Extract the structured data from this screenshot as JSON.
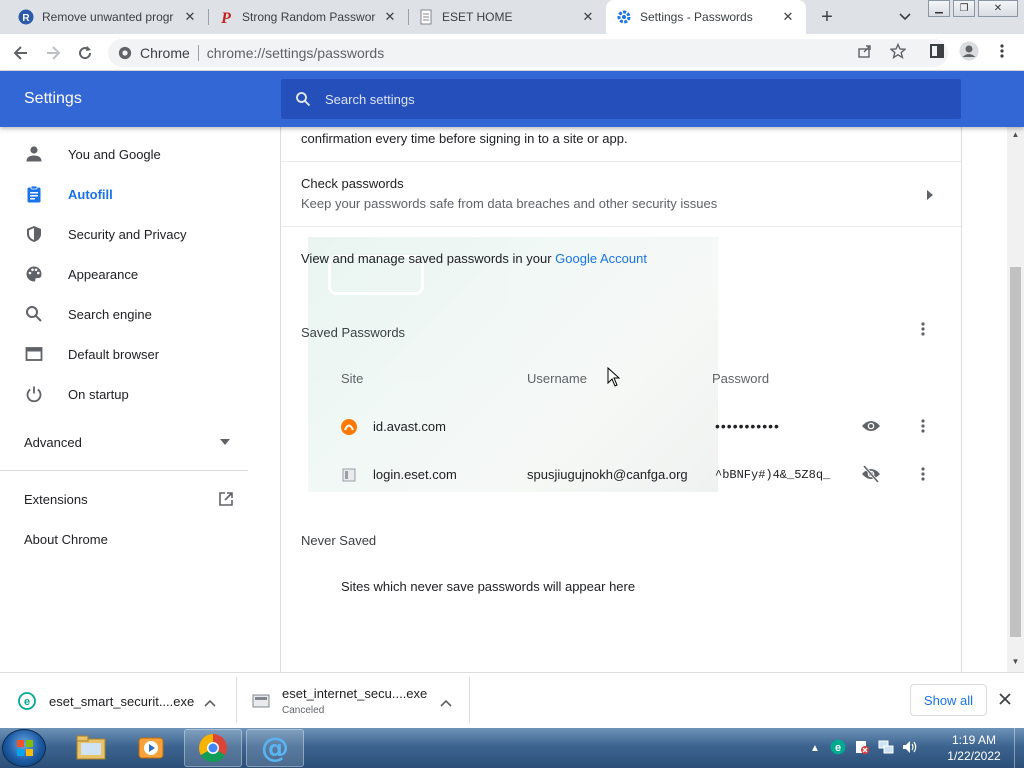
{
  "browser": {
    "tabs": [
      {
        "title": "Remove unwanted progr",
        "favicon": "reimage-icon",
        "active": false
      },
      {
        "title": "Strong Random Passwor",
        "favicon": "password-generator-icon",
        "active": false
      },
      {
        "title": "ESET HOME",
        "favicon": "page-icon",
        "active": false
      },
      {
        "title": "Settings - Passwords",
        "favicon": "gear-icon",
        "active": true
      }
    ],
    "omnibox": {
      "chip": "Chrome",
      "url": "chrome://settings/passwords"
    }
  },
  "settings": {
    "title": "Settings",
    "search_placeholder": "Search settings",
    "nav": [
      {
        "label": "You and Google",
        "icon": "person-icon"
      },
      {
        "label": "Autofill",
        "icon": "clipboard-icon",
        "selected": true
      },
      {
        "label": "Security and Privacy",
        "icon": "shield-icon"
      },
      {
        "label": "Appearance",
        "icon": "palette-icon"
      },
      {
        "label": "Search engine",
        "icon": "search-icon"
      },
      {
        "label": "Default browser",
        "icon": "browser-icon"
      },
      {
        "label": "On startup",
        "icon": "power-icon"
      }
    ],
    "advanced_label": "Advanced",
    "extensions_label": "Extensions",
    "about_label": "About Chrome"
  },
  "passwords": {
    "confirm_text": "confirmation every time before signing in to a site or app.",
    "check_title": "Check passwords",
    "check_desc": "Keep your passwords safe from data breaches and other security issues",
    "manage_prefix": "View and manage saved passwords in your ",
    "manage_link": "Google Account",
    "saved_title": "Saved Passwords",
    "columns": {
      "site": "Site",
      "username": "Username",
      "password": "Password"
    },
    "entries": [
      {
        "site": "id.avast.com",
        "username": "",
        "password": "•••••••••••",
        "favicon": "avast-icon",
        "eye": "eye-icon"
      },
      {
        "site": "login.eset.com",
        "username": "spusjiugujnokh@canfga.org",
        "password": "^bBNFy#)4&_5Z8q_",
        "favicon": "page-icon",
        "eye": "eye-off-icon"
      }
    ],
    "never_title": "Never Saved",
    "never_empty": "Sites which never save passwords will appear here"
  },
  "downloads": {
    "items": [
      {
        "name": "eset_smart_securit....exe",
        "status": ""
      },
      {
        "name": "eset_internet_secu....exe",
        "status": "Canceled"
      }
    ],
    "show_all": "Show all"
  },
  "taskbar": {
    "time": "1:19 AM",
    "date": "1/22/2022"
  },
  "colors": {
    "accent": "#1a73e8",
    "header": "#3367d6",
    "searchbar": "#254fbb"
  }
}
